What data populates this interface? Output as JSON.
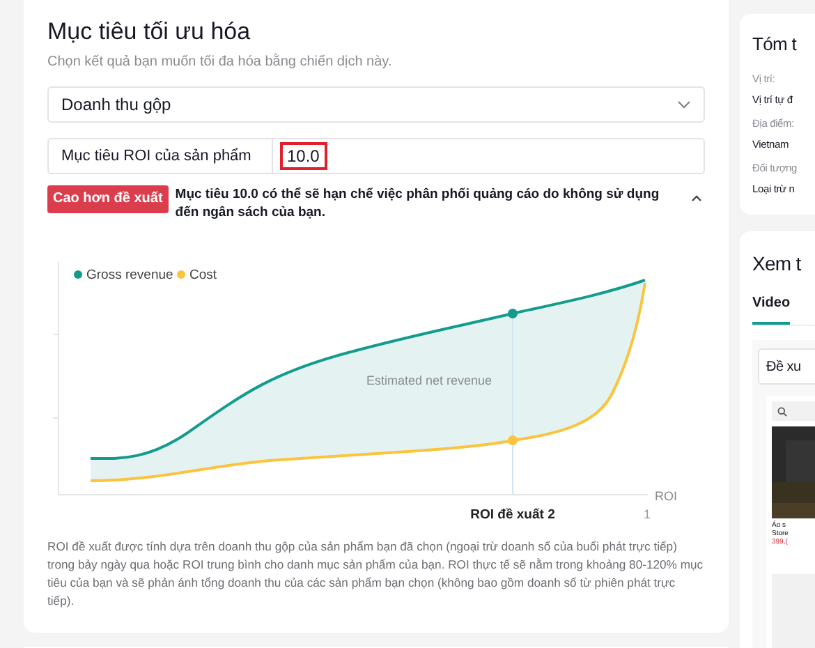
{
  "goal": {
    "title": "Mục tiêu tối ưu hóa",
    "subtitle": "Chọn kết quả bạn muốn tối đa hóa bằng chiến dịch này.",
    "dropdown": {
      "value": "Doanh thu gộp"
    },
    "roi_field": {
      "label": "Mục tiêu ROI của sản phẩm",
      "value": "10.0",
      "invalid": true
    },
    "warning": {
      "badge": "Cao hơn đề xuất",
      "message": "Mục tiêu 10.0 có thể sẽ hạn chế việc phân phối quảng cáo do không sử dụng đến ngân sách của bạn.",
      "expanded": true
    },
    "chart": {
      "legend": [
        {
          "label": "Gross revenue",
          "color": "#139c8e"
        },
        {
          "label": "Cost",
          "color": "#fcc33c"
        }
      ],
      "area_label": "Estimated net revenue",
      "axis_label": "ROI",
      "marker_label": "ROI đề xuất 2",
      "end_label": "1"
    },
    "note": "ROI đề xuất được tính dựa trên doanh thu gộp của sản phẩm bạn đã chọn (ngoại trừ doanh số của buổi phát trực tiếp) trong bảy ngày qua hoặc ROI trung bình cho danh mục sản phẩm của bạn. ROI thực tế sẽ nằm trong khoảng 80-120% mục tiêu của bạn và sẽ phản ánh tổng doanh thu của các sản phẩm bạn chọn (không bao gồm doanh số từ phiên phát trực tiếp)."
  },
  "summary": {
    "title": "Tóm t",
    "fields": [
      {
        "label": "Vị trí:",
        "value": "Vị trí tự đ"
      },
      {
        "label": "Địa điểm:",
        "value": "Vietnam"
      },
      {
        "label": "Đối tượng",
        "value": "Loại trừ n"
      }
    ]
  },
  "preview": {
    "title": "Xem t",
    "tabs": [
      {
        "label": "Video",
        "selected": true
      }
    ],
    "dropdown": {
      "value": "Đề xu"
    },
    "product": {
      "name": "Áo s",
      "store": "Store",
      "price": "399,("
    }
  }
}
